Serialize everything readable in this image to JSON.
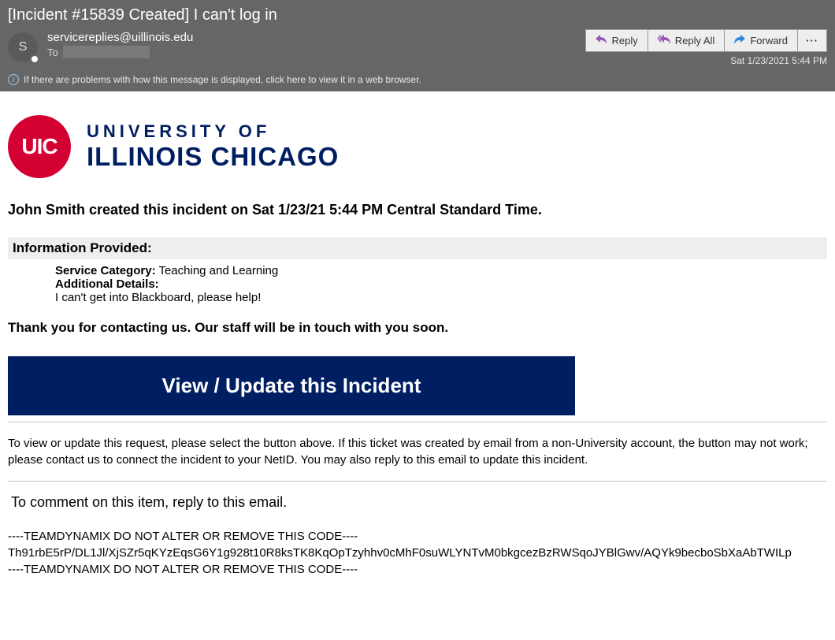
{
  "header": {
    "subject": "[Incident #15839 Created] I can't log in",
    "avatar_initial": "S",
    "sender": "servicereplies@uillinois.edu",
    "to_label": "To",
    "timestamp": "Sat 1/23/2021 5:44 PM",
    "info_bar": "If there are problems with how this message is displayed, click here to view it in a web browser."
  },
  "actions": {
    "reply": "Reply",
    "reply_all": "Reply All",
    "forward": "Forward",
    "more": "···"
  },
  "logo": {
    "circle_text": "UIC",
    "line1": "UNIVERSITY OF",
    "line2": "ILLINOIS CHICAGO"
  },
  "body": {
    "created_line": "John Smith created this incident on Sat 1/23/21 5:44 PM Central Standard Time.",
    "info_header": "Information Provided:",
    "service_category_label": "Service Category:",
    "service_category_value": " Teaching and Learning",
    "additional_details_label": "Additional Details:",
    "additional_details_value": "I can't get into Blackboard, please help!",
    "thankyou": "Thank you for contacting us. Our staff will be in touch with you soon.",
    "view_button": "View / Update this Incident",
    "instructions": "To view or update this request, please select the button above. If this ticket was created by email from a non-University account, the button may not work; please contact us to connect the incident to your NetID. You may also reply to this email to update this incident.",
    "comment_hint": "To comment on this item, reply to this email.",
    "code_line1": "----TEAMDYNAMIX DO NOT ALTER OR REMOVE THIS CODE----",
    "code_line2": "Th91rbE5rP/DL1Jl/XjSZr5qKYzEqsG6Y1g928t10R8ksTK8KqOpTzyhhv0cMhF0suWLYNTvM0bkgcezBzRWSqoJYBlGwv/AQYk9becboSbXaAbTWILp",
    "code_line3": "----TEAMDYNAMIX DO NOT ALTER OR REMOVE THIS CODE----"
  }
}
